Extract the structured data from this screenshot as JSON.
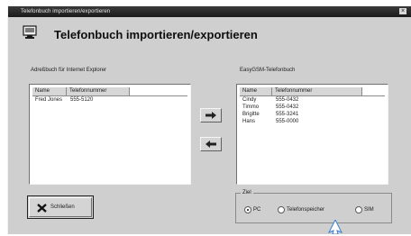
{
  "window": {
    "title": "Telefonbuch importieren/exportieren",
    "close_glyph": "×"
  },
  "header": {
    "icon": "phonebook-icon",
    "title": "Telefonbuch importieren/exportieren"
  },
  "left_list": {
    "label": "Adreßbuch für Internet Explorer",
    "columns": [
      "Name",
      "Telefonnummer"
    ],
    "rows": [
      {
        "name": "Fred Jones",
        "number": "555-5120"
      }
    ]
  },
  "right_list": {
    "label": "EasyGSM-Telefonbuch",
    "columns": [
      "Name",
      "Telefonnummer"
    ],
    "rows": [
      {
        "name": "Cindy",
        "number": "555-0432"
      },
      {
        "name": "Timmo",
        "number": "555-0432"
      },
      {
        "name": "Brigitte",
        "number": "555-3241"
      },
      {
        "name": "Hans",
        "number": "555-0000"
      }
    ]
  },
  "transfer": {
    "right_icon": "arrow-right-icon",
    "left_icon": "arrow-left-icon"
  },
  "close_button": {
    "label": "Schließen",
    "icon": "x-close-icon"
  },
  "target_group": {
    "label": "Ziel",
    "options": [
      {
        "label": "PC",
        "selected": true
      },
      {
        "label": "Telefonspeicher",
        "selected": false
      },
      {
        "label": "SIM",
        "selected": false
      }
    ]
  }
}
